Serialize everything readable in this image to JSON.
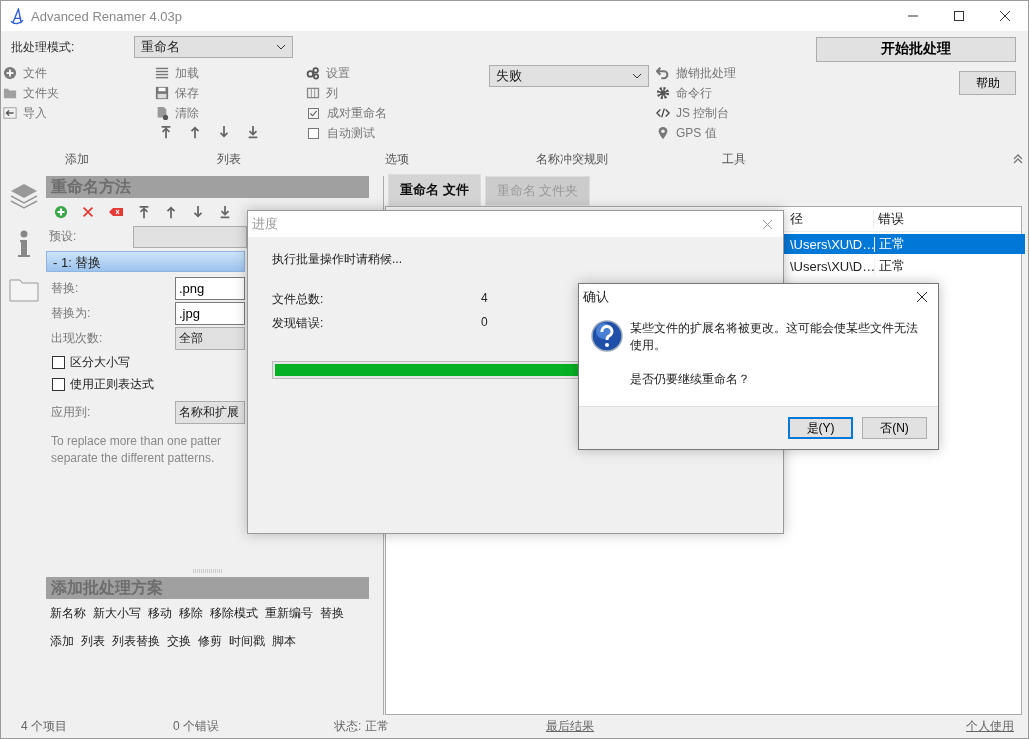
{
  "window": {
    "title": "Advanced Renamer 4.03p"
  },
  "toolbar": {
    "batch_mode_label": "批处理模式:",
    "batch_mode": "重命名",
    "start_button": "开始批处理",
    "help_button": "帮助",
    "add_items": [
      "文件",
      "文件夹",
      "导入"
    ],
    "list_items": [
      "加载",
      "保存",
      "清除"
    ],
    "option_items": [
      {
        "kind": "button",
        "label": "设置"
      },
      {
        "kind": "button",
        "label": "列"
      },
      {
        "kind": "checkbox",
        "label": "成对重命名",
        "checked": true
      },
      {
        "kind": "checkbox",
        "label": "自动测试",
        "checked": false
      }
    ],
    "conflict_rule": "失败",
    "tool_items": [
      "撤销批处理",
      "命令行",
      "JS 控制台",
      "GPS 值"
    ],
    "group_labels": [
      "添加",
      "列表",
      "选项",
      "名称冲突规则",
      "工具"
    ]
  },
  "methods_panel": {
    "title": "重命名方法",
    "preset_label": "预设:",
    "method_item": {
      "label": "-  1: 替换",
      "selected": true
    },
    "fields": [
      {
        "kind": "input",
        "label": "替换:",
        "value": ".png"
      },
      {
        "kind": "input",
        "label": "替换为:",
        "value": ".jpg"
      },
      {
        "kind": "select",
        "label": "出现次数:",
        "value": "全部"
      }
    ],
    "checkboxes": [
      {
        "label": "区分大小写",
        "checked": false
      },
      {
        "label": "使用正则表达式",
        "checked": false
      }
    ],
    "apply_label": "应用到:",
    "apply_value": "名称和扩展",
    "help_lines": [
      "To replace more than one patter",
      "separate the different patterns."
    ]
  },
  "add_methods": {
    "title": "添加批处理方案",
    "lines": [
      {
        "links": [
          "新名称",
          "新大小写",
          "移动",
          "移除",
          "移除模式",
          "重新编号",
          "替换"
        ]
      },
      {
        "links": [
          "添加",
          "列表",
          "列表替换",
          "交换",
          "修剪",
          "时间戳",
          "脚本"
        ]
      }
    ]
  },
  "tabs": [
    {
      "label": "重命名 文件",
      "selected": true
    },
    {
      "label": "重命名 文件夹",
      "selected": false
    }
  ],
  "file_list": {
    "columns": [
      "径",
      "错误"
    ],
    "rows": [
      {
        "path": "\\Users\\XU\\D…",
        "error": "正常",
        "selected": true
      },
      {
        "path": "\\Users\\XU\\D…",
        "error": "正常",
        "selected": false
      }
    ]
  },
  "status_bar": {
    "items": "4  个项目",
    "errors": "0  个错误",
    "status": "状态: 正常",
    "last_result": "最后结果",
    "license": "个人使用"
  },
  "progress_dialog": {
    "title": "进度",
    "message": "执行批量操作时请稍候...",
    "stats": [
      {
        "label": "文件总数:",
        "value": "4"
      },
      {
        "label": "发现错误:",
        "value": "0"
      }
    ],
    "level": 1
  },
  "confirm_dialog": {
    "title": "确认",
    "message": "某些文件的扩展名将被更改。这可能会使某些文件无法使用。",
    "question": "是否仍要继续重命名？",
    "buttons": [
      {
        "label": "是(Y)",
        "focused": true
      },
      {
        "label": "否(N)",
        "focused": false
      }
    ]
  }
}
